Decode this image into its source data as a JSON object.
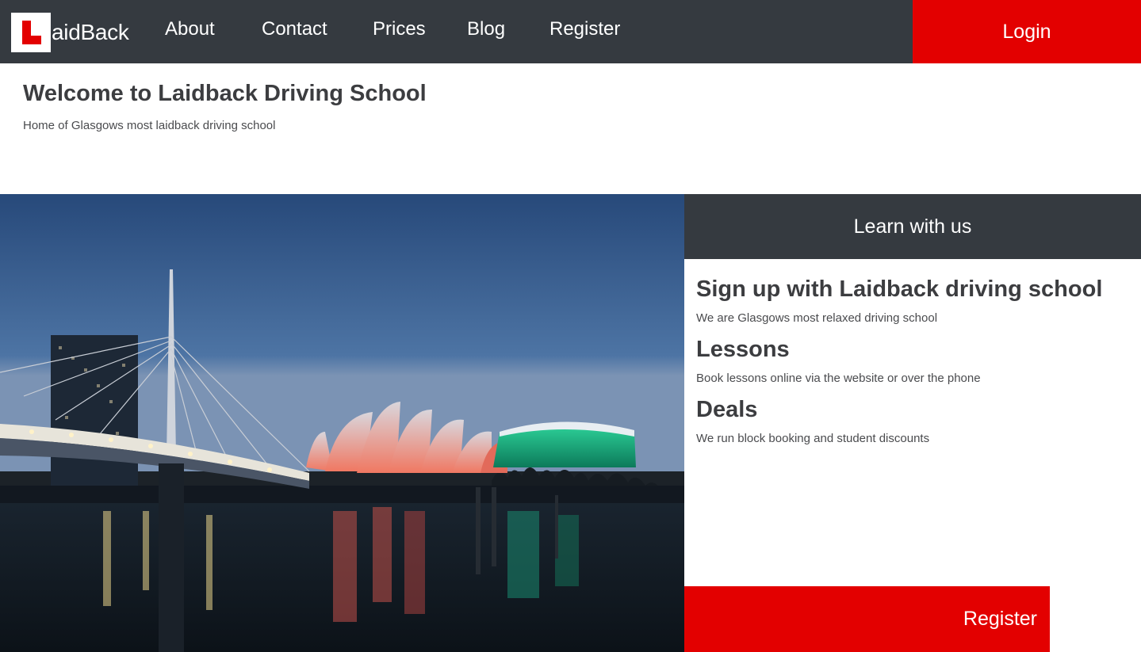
{
  "brand": {
    "logo_text": "aidBack",
    "colors": {
      "nav_bg": "#353a40",
      "accent_red": "#e30000",
      "text_dark": "#3c3d40"
    }
  },
  "nav": {
    "items": [
      {
        "label": "About"
      },
      {
        "label": "Contact"
      },
      {
        "label": "Prices"
      },
      {
        "label": "Blog"
      },
      {
        "label": "Register"
      }
    ],
    "login_label": "Login"
  },
  "header": {
    "title": "Welcome to Laidback Driving School",
    "subtitle": "Home of Glasgows most laidback driving school"
  },
  "hero": {
    "icon": "glasgow-skyline-image"
  },
  "panel": {
    "heading": "Learn with us",
    "sections": [
      {
        "title": "Sign up with Laidback driving school",
        "text": "We are Glasgows most relaxed driving school"
      },
      {
        "title": "Lessons",
        "text": "Book lessons online via the website or over the phone"
      },
      {
        "title": "Deals",
        "text": "We run block booking and student discounts"
      }
    ],
    "register_label": "Register"
  }
}
